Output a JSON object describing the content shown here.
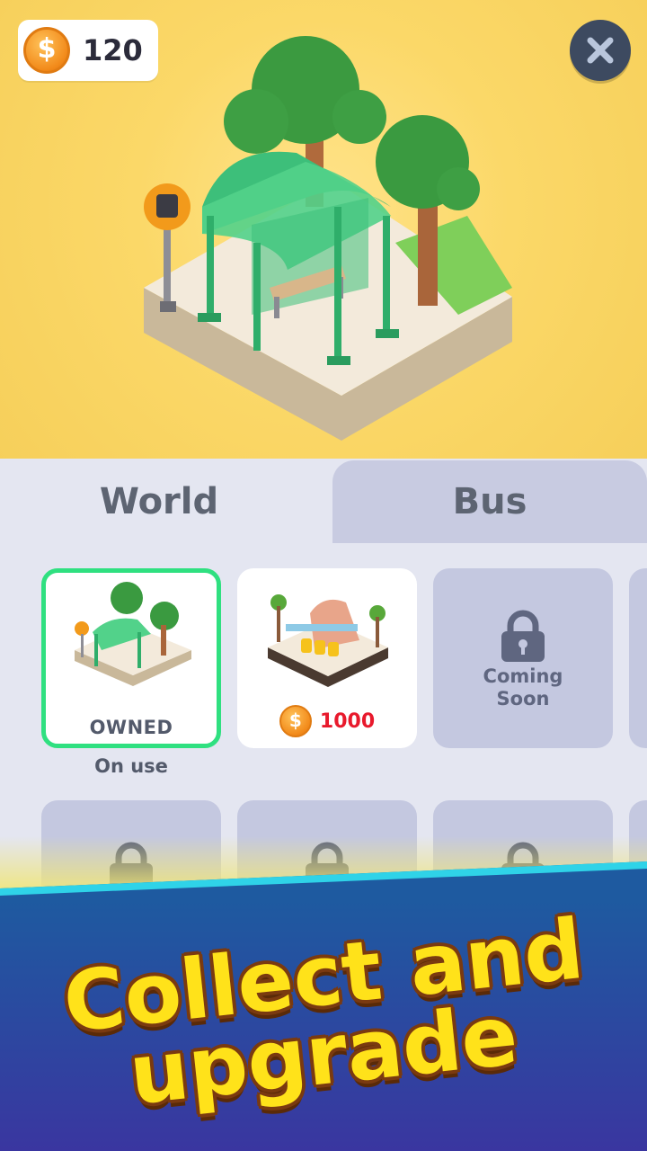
{
  "header": {
    "coin_icon": "coin-icon",
    "coin_symbol": "$",
    "coin_count": "120",
    "close_icon": "close-icon"
  },
  "tabs": [
    {
      "label": "World",
      "active": true
    },
    {
      "label": "Bus",
      "active": false
    }
  ],
  "items": [
    {
      "status": "OWNED",
      "subtitle": "On use",
      "state": "owned"
    },
    {
      "price": "1000",
      "currency_symbol": "$",
      "state": "shop"
    },
    {
      "text_line1": "Coming",
      "text_line2": "Soon",
      "state": "locked"
    }
  ],
  "banner": {
    "line1": "Collect and",
    "line2": "upgrade"
  },
  "colors": {
    "hero_bg": "#f9d565",
    "panel_bg": "#e4e6f1",
    "owned_border": "#2fe080",
    "price_red": "#e8192c",
    "locked_card": "#c4c8e0",
    "headline_yellow": "#ffe21a",
    "banner_blue": "#2a4aa0"
  }
}
